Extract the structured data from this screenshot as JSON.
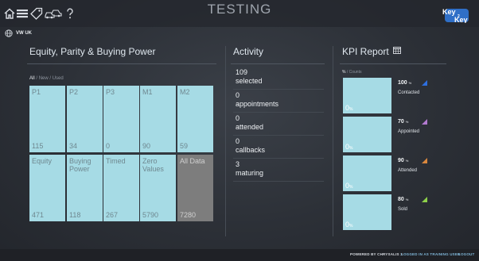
{
  "header": {
    "title": "TESTING",
    "icons": [
      "home-icon",
      "menu-icon",
      "tag-icon",
      "cars-icon",
      "help-icon"
    ],
    "logo_text": [
      "Key",
      "2",
      "Key"
    ]
  },
  "region": {
    "label": "VW UK",
    "icon": "globe-icon"
  },
  "equity": {
    "title": "Equity, Parity & Buying Power",
    "filters": {
      "all": "All",
      "sep1": " / ",
      "new": "New",
      "sep2": " / ",
      "used": "Used"
    },
    "tiles": [
      {
        "label": "P1",
        "value": "115"
      },
      {
        "label": "P2",
        "value": "34"
      },
      {
        "label": "P3",
        "value": "0"
      },
      {
        "label": "M1",
        "value": "90"
      },
      {
        "label": "M2",
        "value": "59"
      },
      {
        "label": "Equity",
        "value": "471"
      },
      {
        "label": "Buying Power",
        "value": "118"
      },
      {
        "label": "Timed",
        "value": "267"
      },
      {
        "label": "Zero Values",
        "value": "5790"
      },
      {
        "label": "All Data",
        "value": "7280"
      }
    ]
  },
  "activity": {
    "title": "Activity",
    "items": [
      {
        "num": "109",
        "label": "selected"
      },
      {
        "num": "0",
        "label": "appointments"
      },
      {
        "num": "0",
        "label": "attended"
      },
      {
        "num": "0",
        "label": "callbacks"
      },
      {
        "num": "3",
        "label": "maturing"
      }
    ]
  },
  "kpi": {
    "title": "KPI Report",
    "toggle": {
      "pct": "%",
      "sep": " / ",
      "counts": "Counts"
    },
    "items": [
      {
        "block_value": "0",
        "block_unit": "%",
        "percent": "100",
        "unit": "%",
        "label": "Contacted",
        "color": "#2e6fe0"
      },
      {
        "block_value": "0",
        "block_unit": "%",
        "percent": "70",
        "unit": "%",
        "label": "Appointed",
        "color": "#b27ad0"
      },
      {
        "block_value": "0",
        "block_unit": "%",
        "percent": "90",
        "unit": "%",
        "label": "Attended",
        "color": "#d9873e"
      },
      {
        "block_value": "0",
        "block_unit": "%",
        "percent": "80",
        "unit": "%",
        "label": "Sold",
        "color": "#8ed14a"
      }
    ]
  },
  "footer": {
    "powered": "POWERED BY CHRYSALIS 3",
    "logged": "LOGGED IN AS TRAINING USER",
    "logout": "LOGOUT"
  }
}
